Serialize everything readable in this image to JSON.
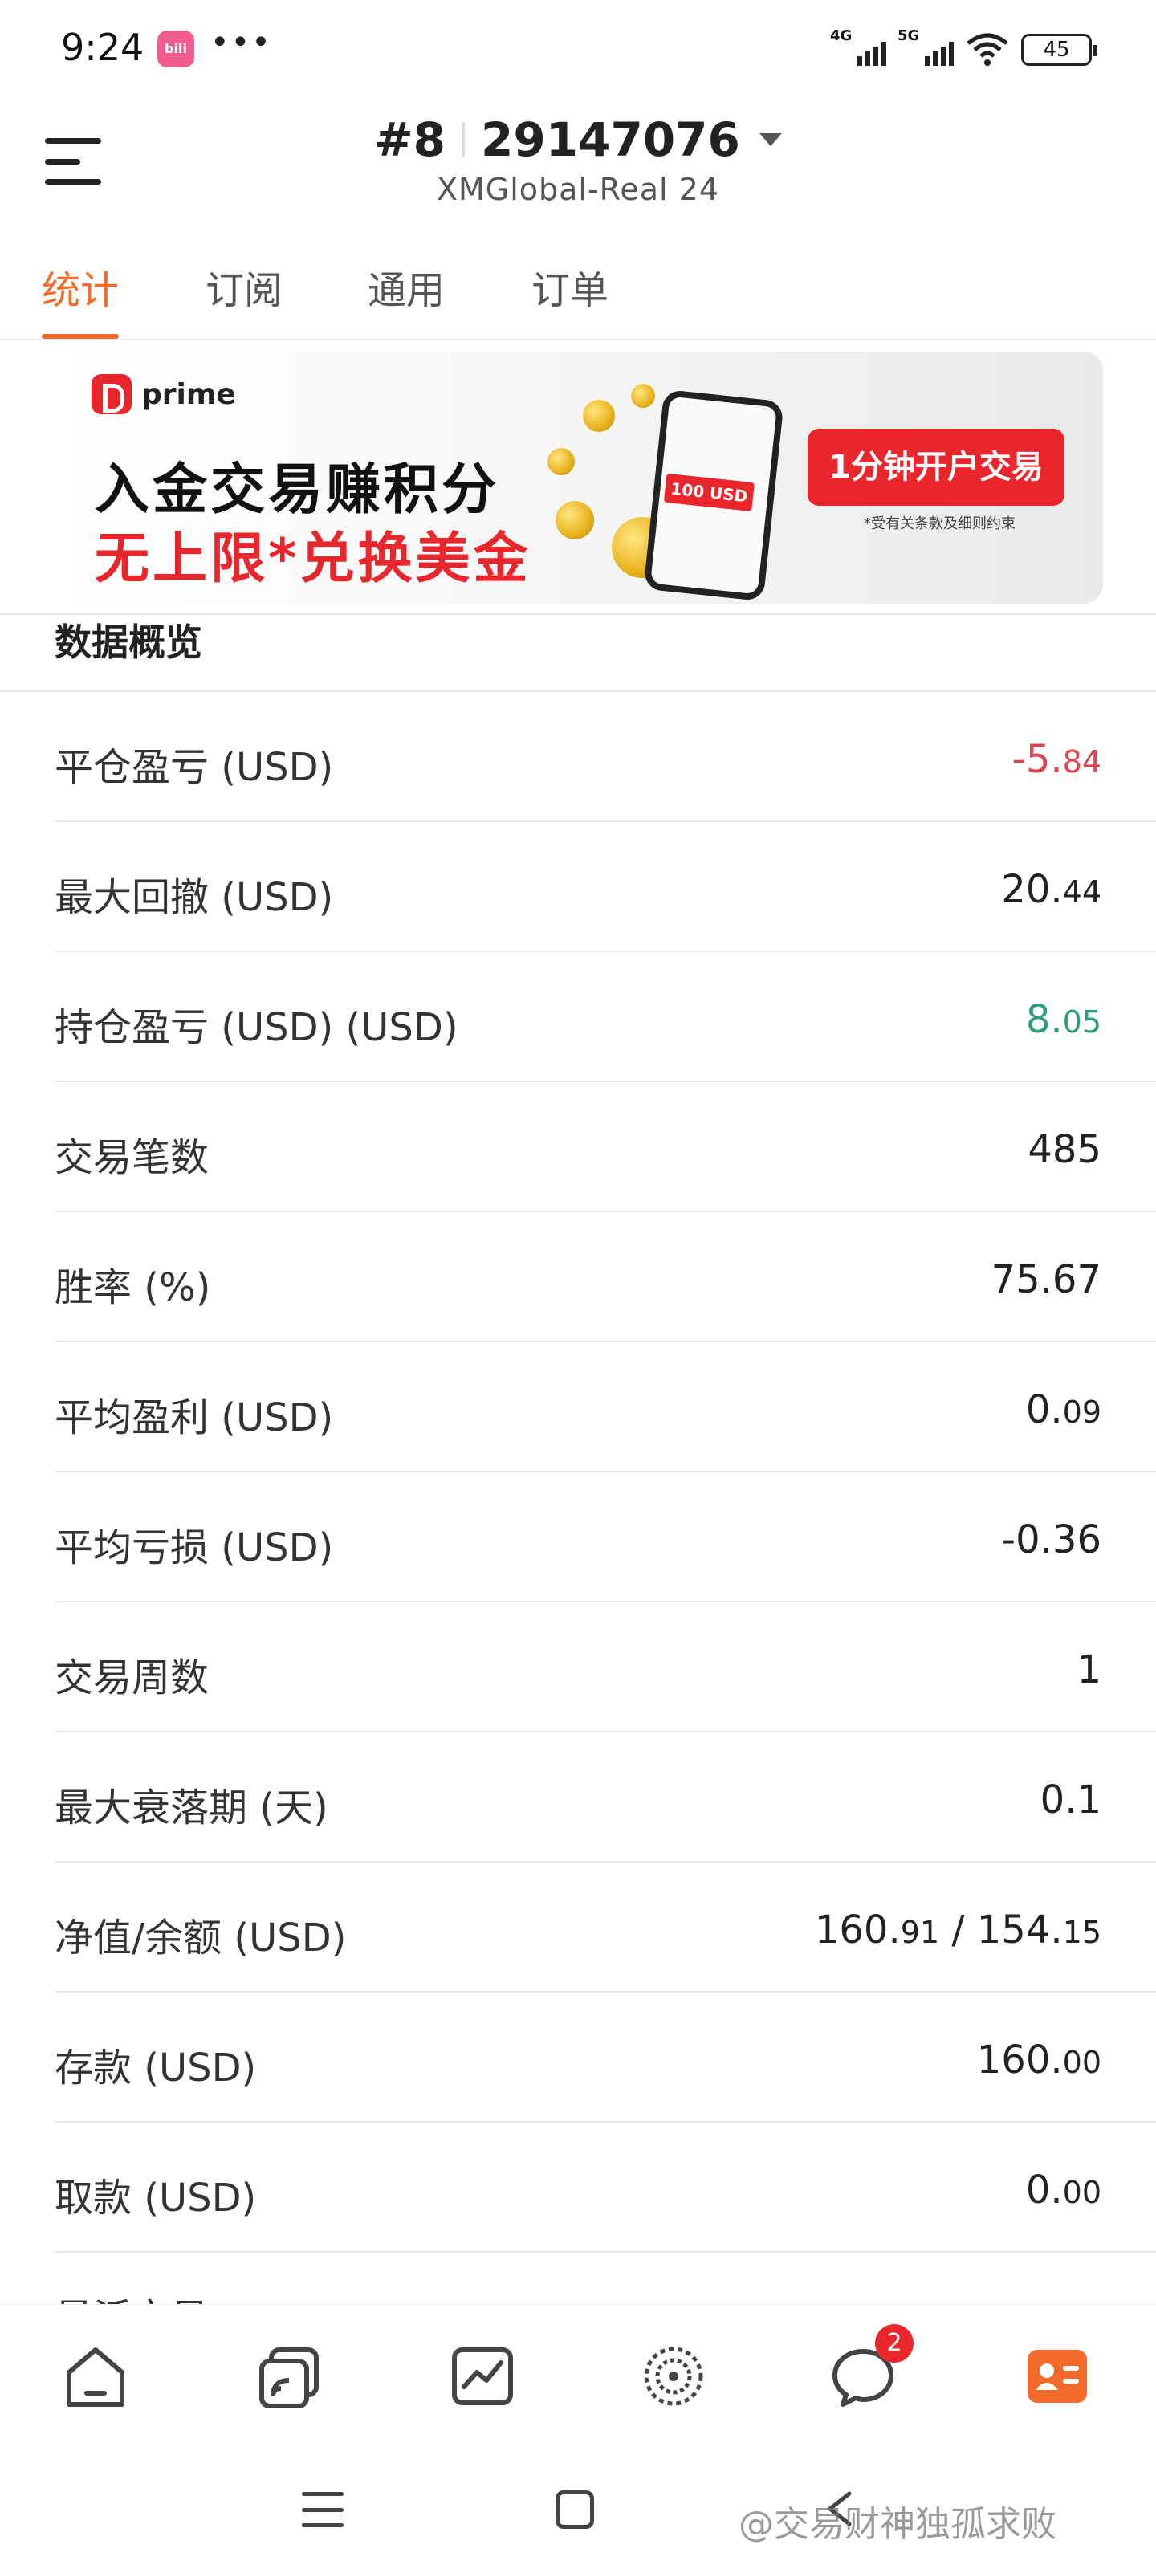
{
  "status_bar": {
    "time": "9:24",
    "app_icon": "bilibili-icon",
    "dots": "•••",
    "signal_1_label": "4G",
    "signal_2_label": "5G",
    "battery": "45"
  },
  "header": {
    "account_prefix": "#8",
    "account_number": "29147076",
    "server": "XMGlobal-Real 24"
  },
  "tabs": [
    {
      "label": "统计",
      "active": true
    },
    {
      "label": "订阅",
      "active": false
    },
    {
      "label": "通用",
      "active": false
    },
    {
      "label": "订单",
      "active": false
    }
  ],
  "banner": {
    "brand": "prime",
    "line1": "入金交易赚积分",
    "line2": "无上限*兑换美金",
    "phone_badge": "100 USD",
    "cta": "1分钟开户交易",
    "note": "*受有关条款及细则约束"
  },
  "section": {
    "title": "数据概览"
  },
  "stats": [
    {
      "label": "平仓盈亏 (USD)",
      "int": "-5.",
      "dec": "84",
      "tone": "neg"
    },
    {
      "label": "最大回撤 (USD)",
      "int": "20.",
      "dec": "44",
      "tone": ""
    },
    {
      "label": "持仓盈亏 (USD) (USD)",
      "int": "8.",
      "dec": "05",
      "tone": "pos"
    },
    {
      "label": "交易笔数",
      "int": "485",
      "dec": "",
      "tone": ""
    },
    {
      "label": "胜率 (%)",
      "int": "75.67",
      "dec": "",
      "tone": ""
    },
    {
      "label": "平均盈利 (USD)",
      "int": "0.",
      "dec": "09",
      "tone": ""
    },
    {
      "label": "平均亏损 (USD)",
      "int": "-0.36",
      "dec": "",
      "tone": ""
    },
    {
      "label": "交易周数",
      "int": "1",
      "dec": "",
      "tone": ""
    },
    {
      "label": "最大衰落期 (天)",
      "int": "0.1",
      "dec": "",
      "tone": ""
    },
    {
      "label": "净值/余额 (USD)",
      "int": "160.",
      "dec": "91",
      "int2": " / 154.",
      "dec2": "15",
      "tone": ""
    },
    {
      "label": "存款 (USD)",
      "int": "160.",
      "dec": "00",
      "tone": ""
    },
    {
      "label": "取款 (USD)",
      "int": "0.",
      "dec": "00",
      "tone": ""
    }
  ],
  "cutoff_label": "最活交易",
  "bottom_nav": {
    "items": [
      {
        "icon": "home-icon"
      },
      {
        "icon": "copy-trading-icon"
      },
      {
        "icon": "chart-icon"
      },
      {
        "icon": "discover-icon"
      },
      {
        "icon": "chat-icon",
        "badge": "2"
      },
      {
        "icon": "profile-icon",
        "active": true
      }
    ],
    "accent": "#f26b2b"
  },
  "watermark": "@交易财神独孤求败",
  "colors": {
    "accent": "#f26b2b",
    "negative": "#d94652",
    "positive": "#2e9e7a",
    "brand_red": "#e8262c"
  }
}
